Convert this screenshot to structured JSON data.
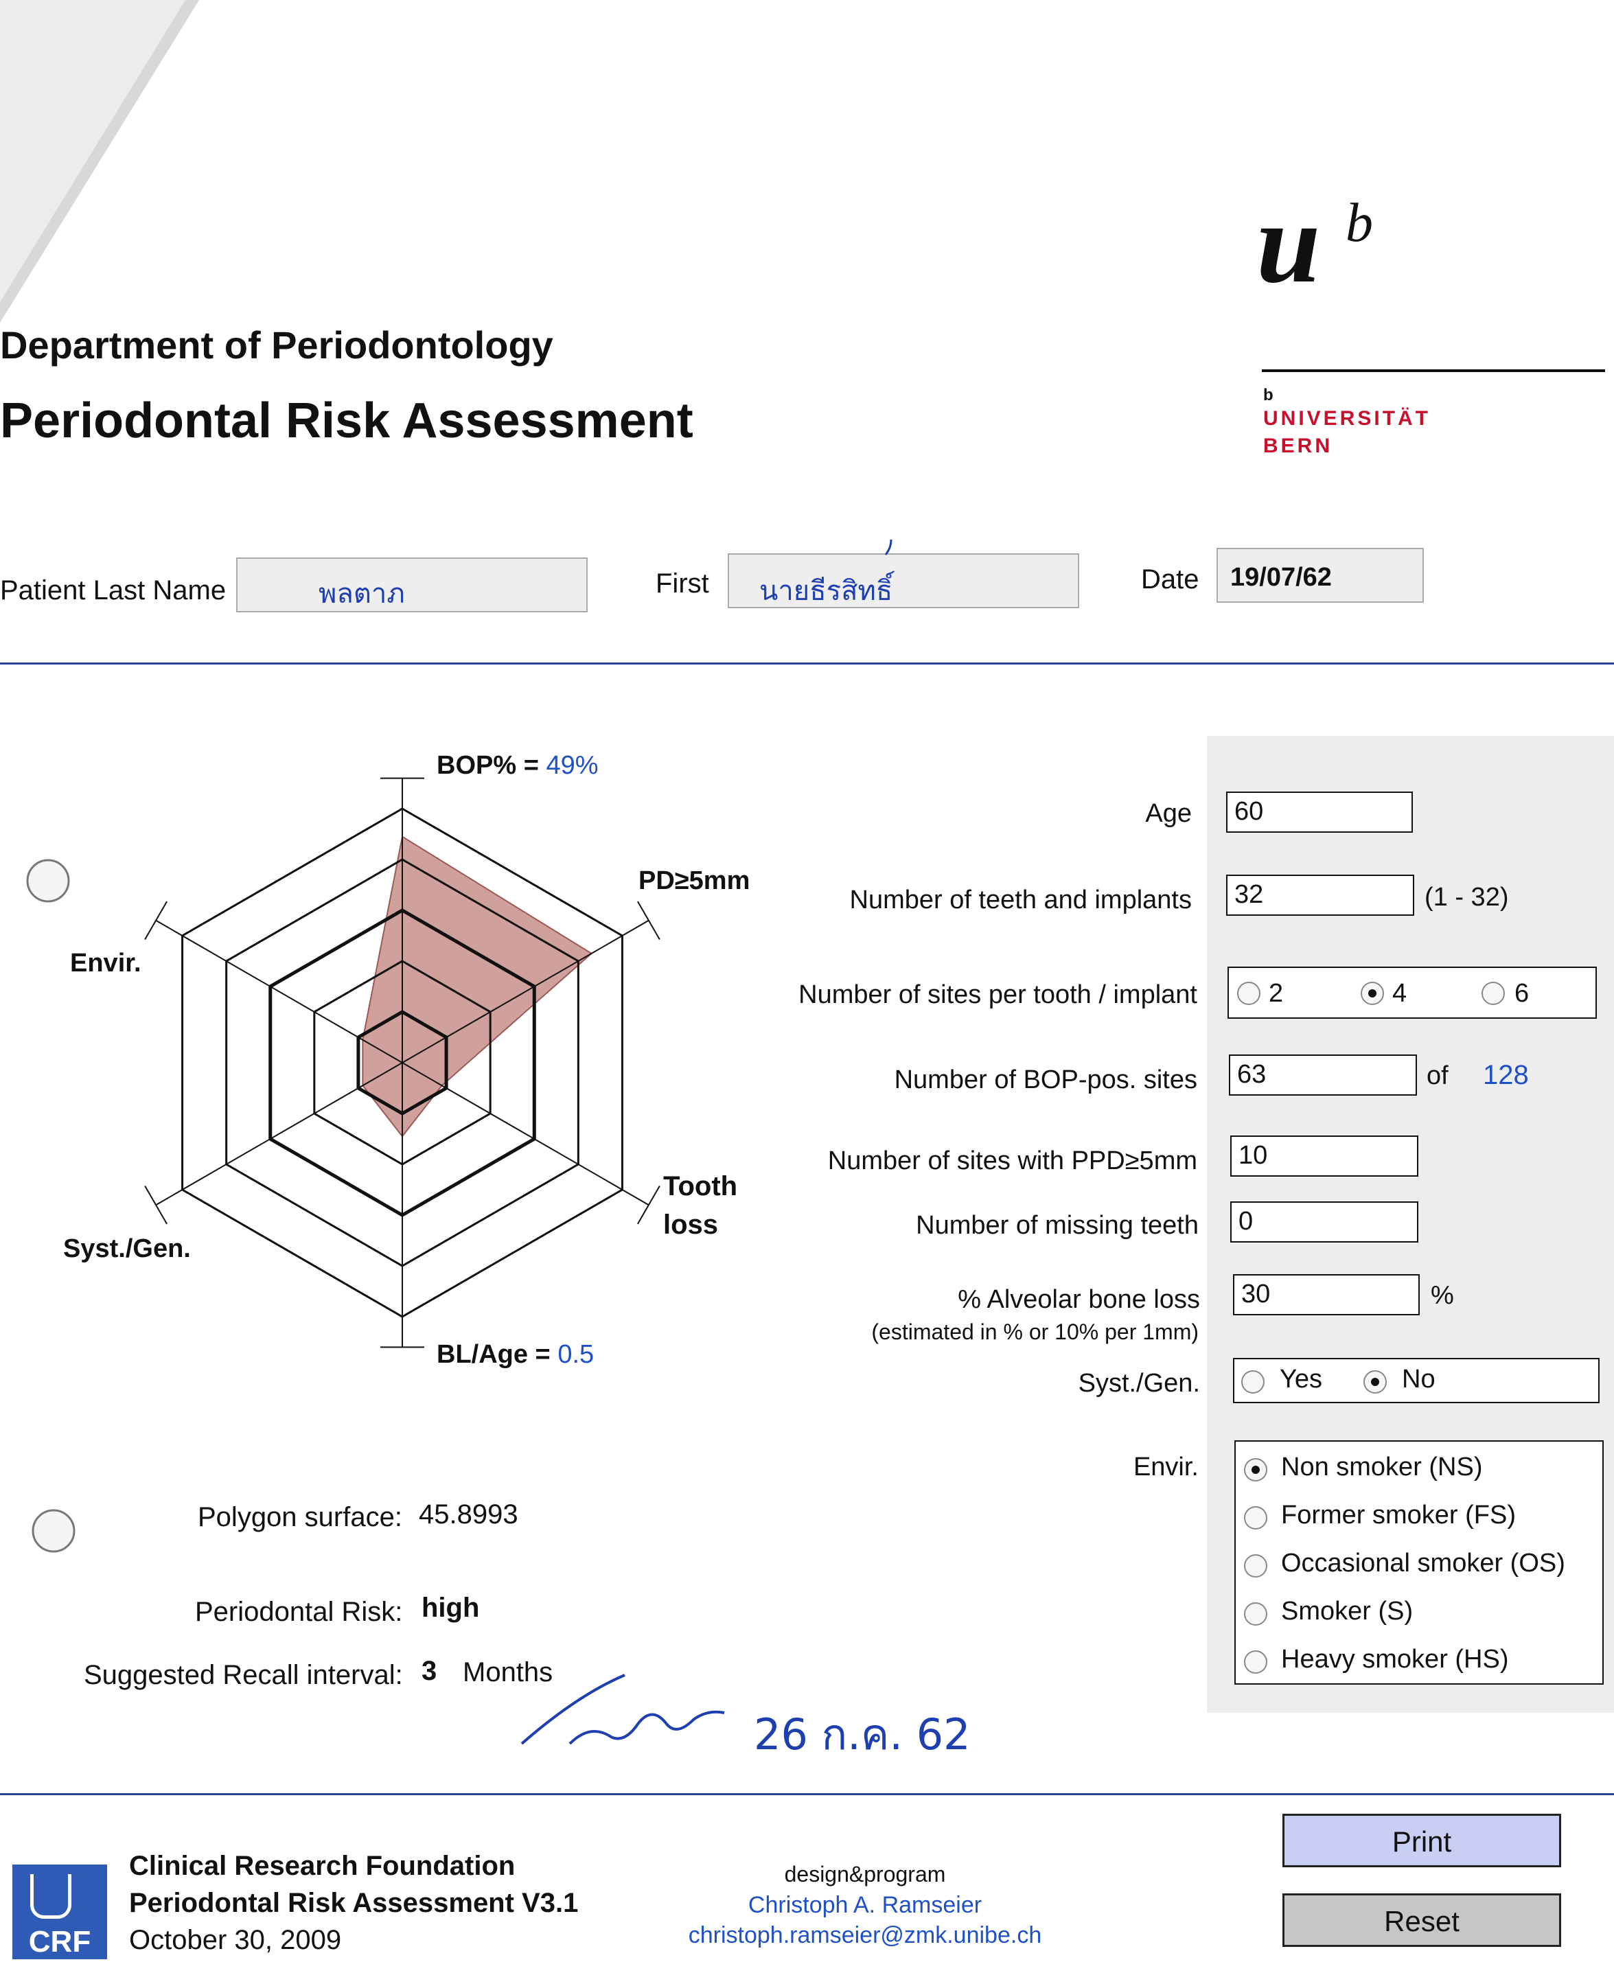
{
  "header": {
    "department": "Department of Periodontology",
    "title": "Periodontal Risk Assessment",
    "logo": {
      "mark": "u",
      "superscript": "b",
      "small_b": "b",
      "university_line1": "UNIVERSITÄT",
      "university_line2": "BERN",
      "color": "#c8102e"
    }
  },
  "patient": {
    "last_name_label": "Patient Last Name",
    "last_name_value": "พลตาภ",
    "first_label": "First",
    "first_value": "นายธีรสิทธิ์",
    "date_label": "Date",
    "date_value": "19/07/62"
  },
  "chart_data": {
    "type": "radar",
    "axes": [
      {
        "label": "BOP% =",
        "value_text": "49%",
        "value": 49
      },
      {
        "label": "PD≥5mm",
        "value": 10
      },
      {
        "label": "Tooth loss",
        "value": 0
      },
      {
        "label": "BL/Age =",
        "value_text": "0.5",
        "value": 0.5
      },
      {
        "label": "Syst./Gen.",
        "value": 0
      },
      {
        "label": "Envir.",
        "value": 0
      }
    ],
    "radius_fraction": [
      0.89,
      0.86,
      0.18,
      0.29,
      0.18,
      0.18
    ],
    "fill_color": "#c0807b",
    "rings": 5
  },
  "results": {
    "polygon_label": "Polygon surface:",
    "polygon_value": "45.8993",
    "risk_label": "Periodontal Risk:",
    "risk_value": "high",
    "recall_label": "Suggested Recall interval:",
    "recall_value": "3",
    "recall_unit": "Months"
  },
  "form": {
    "age_label": "Age",
    "age_value": "60",
    "teeth_label": "Number of teeth and implants",
    "teeth_value": "32",
    "teeth_range": "(1 - 32)",
    "sites_label": "Number of sites per tooth / implant",
    "sites_options": [
      "2",
      "4",
      "6"
    ],
    "sites_selected": "4",
    "bop_label": "Number of BOP-pos. sites",
    "bop_value": "63",
    "bop_of": "of",
    "bop_total": "128",
    "ppd_label": "Number of sites with PPD≥5mm",
    "ppd_value": "10",
    "missing_label": "Number of missing teeth",
    "missing_value": "0",
    "bone_label": "% Alveolar bone loss",
    "bone_sub": "(estimated in % or 10% per 1mm)",
    "bone_value": "30",
    "bone_unit": "%",
    "syst_label": "Syst./Gen.",
    "syst_options": [
      "Yes",
      "No"
    ],
    "syst_selected": "No",
    "envir_label": "Envir.",
    "envir_options": [
      "Non smoker (NS)",
      "Former smoker (FS)",
      "Occasional smoker (OS)",
      "Smoker (S)",
      "Heavy smoker (HS)"
    ],
    "envir_selected": "Non smoker (NS)"
  },
  "handwriting": {
    "signature_date": "26 ก.ค. 62"
  },
  "footer": {
    "logo_text": "CRF",
    "org": "Clinical Research Foundation",
    "product": "Periodontal Risk Assessment V3.1",
    "date": "October 30, 2009",
    "design_label": "design&program",
    "author": "Christoph A. Ramseier",
    "email": "christoph.ramseier@zmk.unibe.ch",
    "print_label": "Print",
    "reset_label": "Reset"
  }
}
